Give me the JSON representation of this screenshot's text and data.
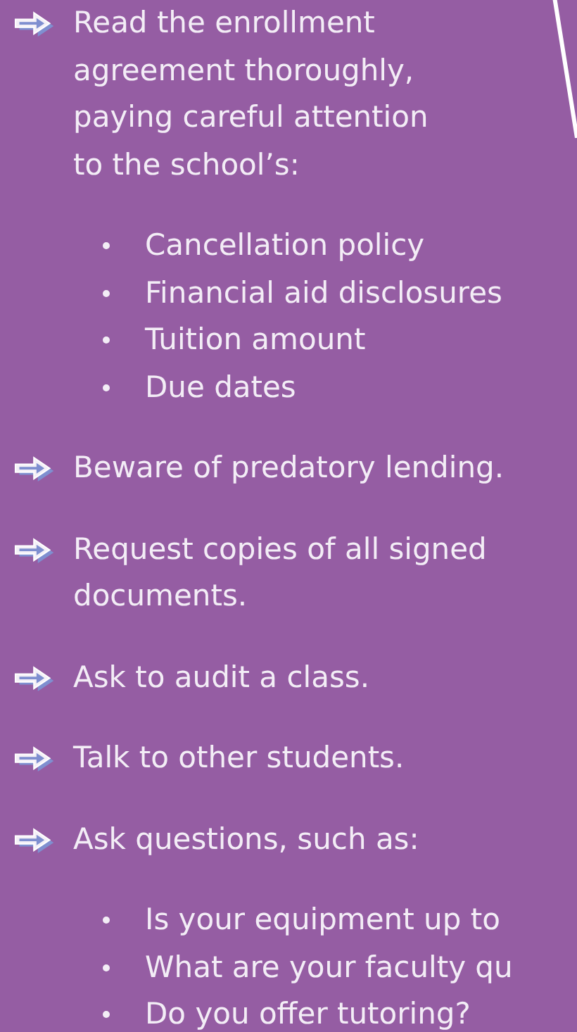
{
  "tips": [
    {
      "text": "Read the enrollment\nagreement thoroughly,\npaying careful attention\nto the school’s:",
      "subitems": [
        "Cancellation policy",
        "Financial aid disclosures",
        "Tuition amount",
        "Due dates"
      ]
    },
    {
      "text": "Beware of predatory lending."
    },
    {
      "text": "Request copies of all signed\ndocuments."
    },
    {
      "text": "Ask to audit a class."
    },
    {
      "text": "Talk to other students."
    },
    {
      "text": "Ask questions, such as:",
      "subitems": [
        "Is your equipment up to",
        "What are your faculty qu",
        "Do you offer tutoring?"
      ]
    }
  ]
}
